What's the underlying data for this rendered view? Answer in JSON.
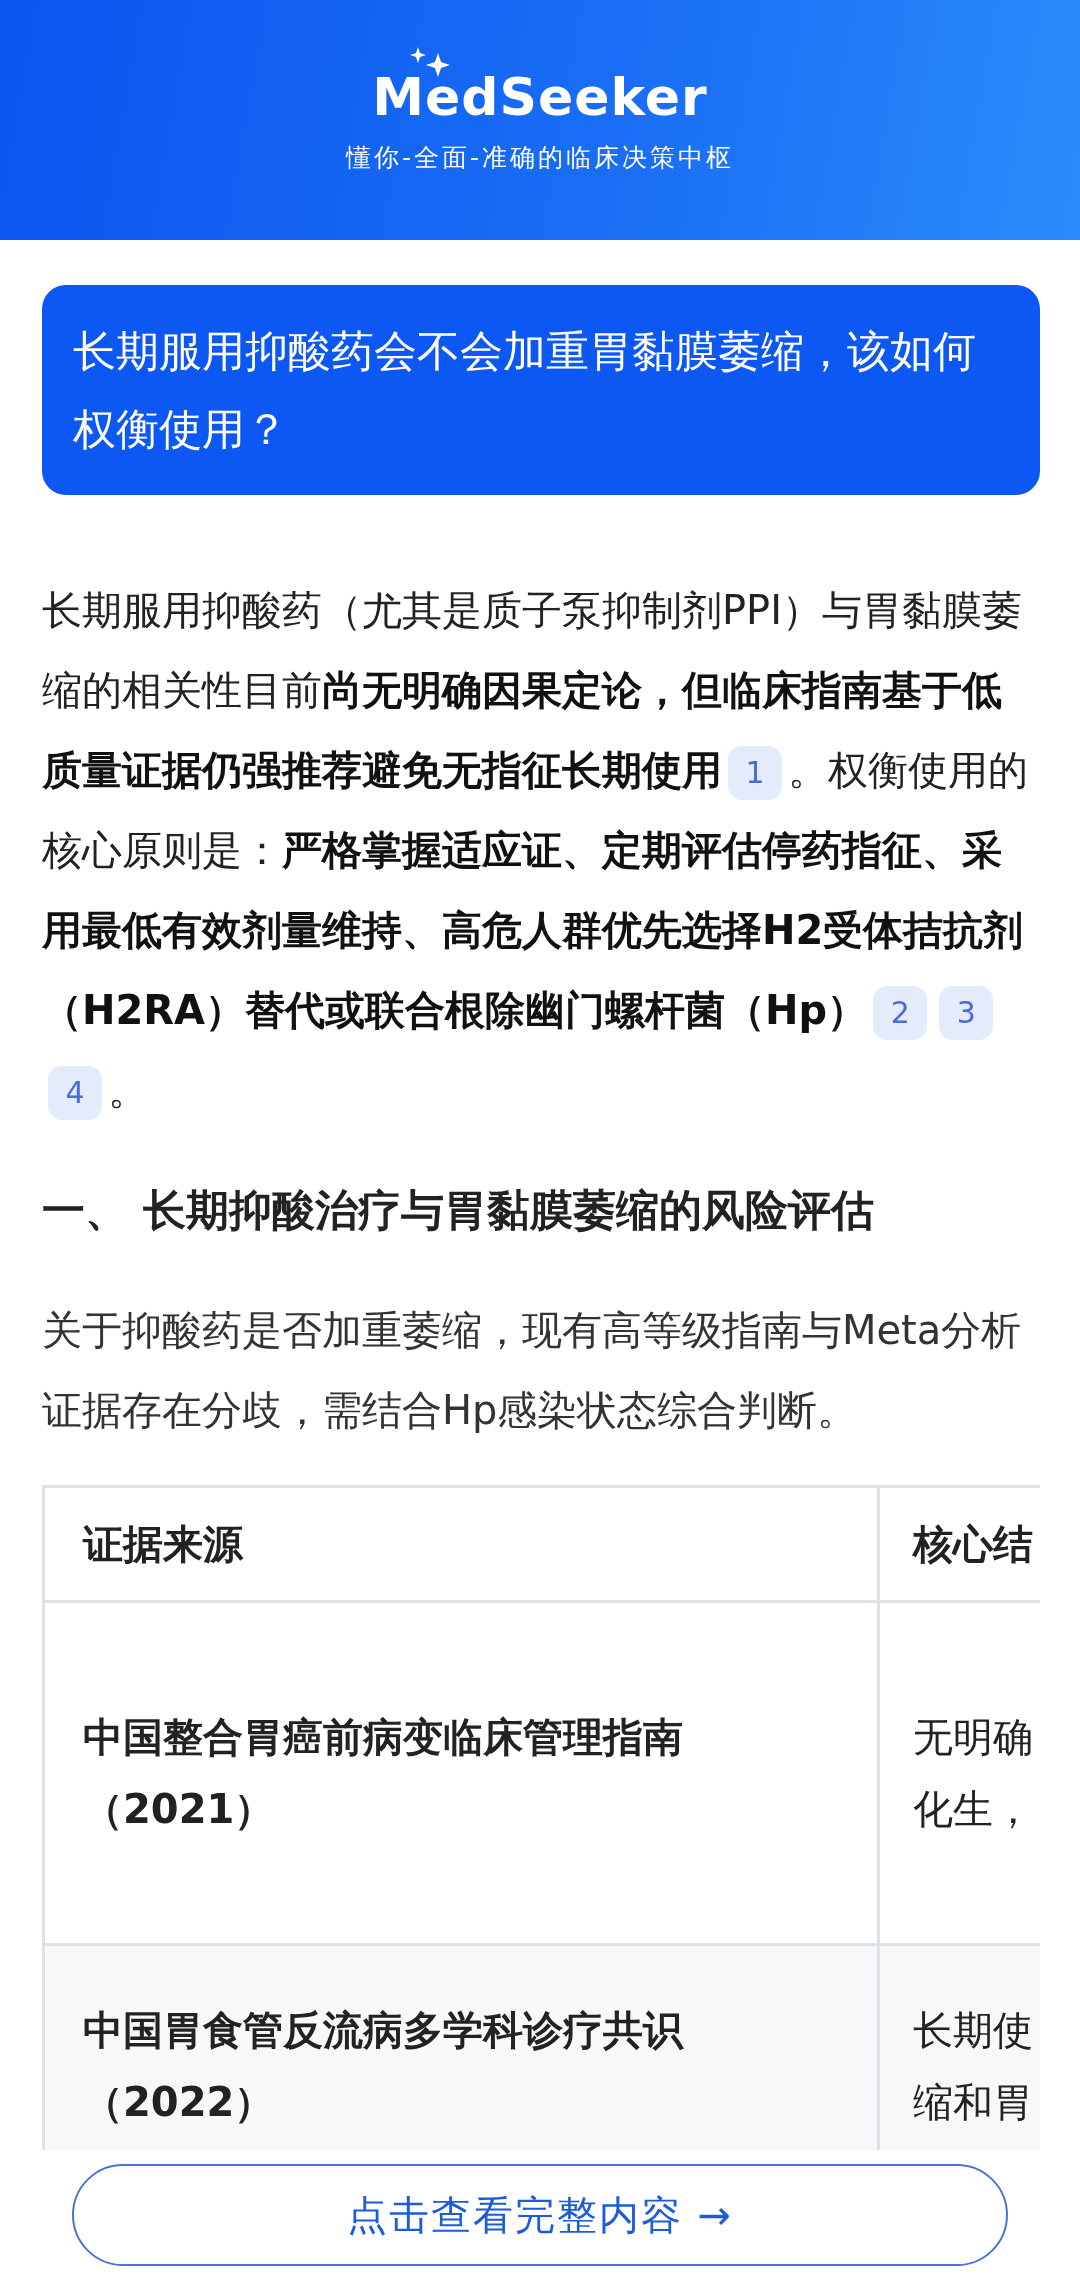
{
  "header": {
    "logo": "MedSeeker",
    "tagline": "懂你-全面-准确的临床决策中枢"
  },
  "question": "长期服用抑酸药会不会加重胃黏膜萎缩，该如何权衡使用？",
  "answer": [
    {
      "kind": "text",
      "text": "长期服用抑酸药（尤其是质子泵抑制剂PPI）与胃黏膜萎缩的相关性目前**尚无明确因果定论，但临床指南基于低质量证据仍强推荐避免无指征长期使用**"
    },
    {
      "kind": "cite",
      "label": "1"
    },
    {
      "kind": "text",
      "text": "。权衡使用的核心原则是：**严格掌握适应证、定期评估停药指征、采用最低有效剂量维持、高危人群优先选择H2受体拮抗剂（H2RA）替代或联合根除幽门螺杆菌（Hp）**"
    },
    {
      "kind": "cite",
      "label": "2"
    },
    {
      "kind": "cite",
      "label": "3"
    },
    {
      "kind": "cite",
      "label": "4"
    },
    {
      "kind": "text",
      "text": "。"
    }
  ],
  "section": {
    "heading": "一、 长期抑酸治疗与胃黏膜萎缩的风险评估",
    "body": "关于抑酸药是否加重萎缩，现有高等级指南与Meta分析证据存在分歧，需结合Hp感染状态综合判断。"
  },
  "table": {
    "columns": [
      "证据来源",
      "核心结"
    ],
    "rows": [
      {
        "column_1": "中国整合胃癌前病变临床管理指南（2021）",
        "column_2": [
          "无明确",
          "化生，"
        ]
      },
      {
        "column_1": "中国胃食管反流病多学科诊疗共识（2022）",
        "column_2": [
          "长期使",
          "缩和胃"
        ]
      }
    ]
  },
  "more_button": "点击查看完整内容 →"
}
